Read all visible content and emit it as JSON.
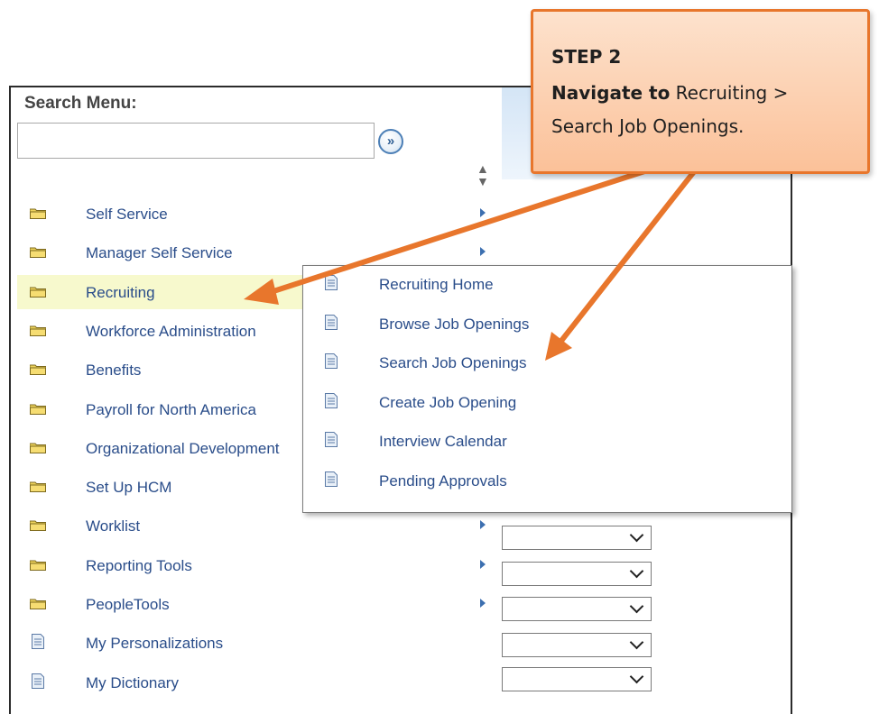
{
  "search_menu": {
    "title": "Search Menu:",
    "input_value": "",
    "go_button": "»"
  },
  "menu_items": [
    {
      "label": "Self Service",
      "icon": "folder-icon",
      "has_submenu": true
    },
    {
      "label": "Manager Self Service",
      "icon": "folder-icon",
      "has_submenu": true
    },
    {
      "label": "Recruiting",
      "icon": "folder-icon",
      "has_submenu": true,
      "selected": true
    },
    {
      "label": "Workforce Administration",
      "icon": "folder-icon",
      "has_submenu": true
    },
    {
      "label": "Benefits",
      "icon": "folder-icon",
      "has_submenu": true
    },
    {
      "label": "Payroll for North America",
      "icon": "folder-icon",
      "has_submenu": true
    },
    {
      "label": "Organizational Development",
      "icon": "folder-icon",
      "has_submenu": true
    },
    {
      "label": "Set Up HCM",
      "icon": "folder-icon",
      "has_submenu": true
    },
    {
      "label": "Worklist",
      "icon": "folder-icon",
      "has_submenu": true
    },
    {
      "label": "Reporting Tools",
      "icon": "folder-icon",
      "has_submenu": true
    },
    {
      "label": "PeopleTools",
      "icon": "folder-icon",
      "has_submenu": true
    },
    {
      "label": "My Personalizations",
      "icon": "document-icon",
      "has_submenu": false
    },
    {
      "label": "My Dictionary",
      "icon": "document-icon",
      "has_submenu": false
    }
  ],
  "submenu_items": [
    {
      "label": "Recruiting Home"
    },
    {
      "label": "Browse Job Openings"
    },
    {
      "label": "Search Job Openings"
    },
    {
      "label": "Create Job Opening"
    },
    {
      "label": "Interview Calendar"
    },
    {
      "label": "Pending Approvals"
    }
  ],
  "callout": {
    "step": "STEP 2",
    "navigate_bold": "Navigate to",
    "navigate_rest": " Recruiting >",
    "line2": "Search Job Openings."
  },
  "colors": {
    "link": "#2a4d8a",
    "callout_border": "#e8762c",
    "arrow": "#e8762c",
    "selected_row": "#f7f9cd"
  }
}
